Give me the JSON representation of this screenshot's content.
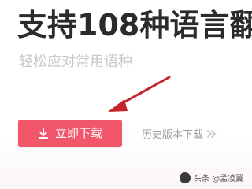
{
  "hero": {
    "title": "支持108种语言翻",
    "subtitle": "轻松应对常用语种"
  },
  "actions": {
    "download_label": "立即下载",
    "download_icon": "download-icon",
    "history_label": "历史版本下载",
    "history_icon": "double-chevron-right-icon"
  },
  "colors": {
    "accent": "#f2566b",
    "annotation_arrow": "#c7212b",
    "title": "#2b2b2b",
    "subtitle": "#c9c9c9"
  },
  "watermark": {
    "text": "头条 @孟凌翼"
  }
}
